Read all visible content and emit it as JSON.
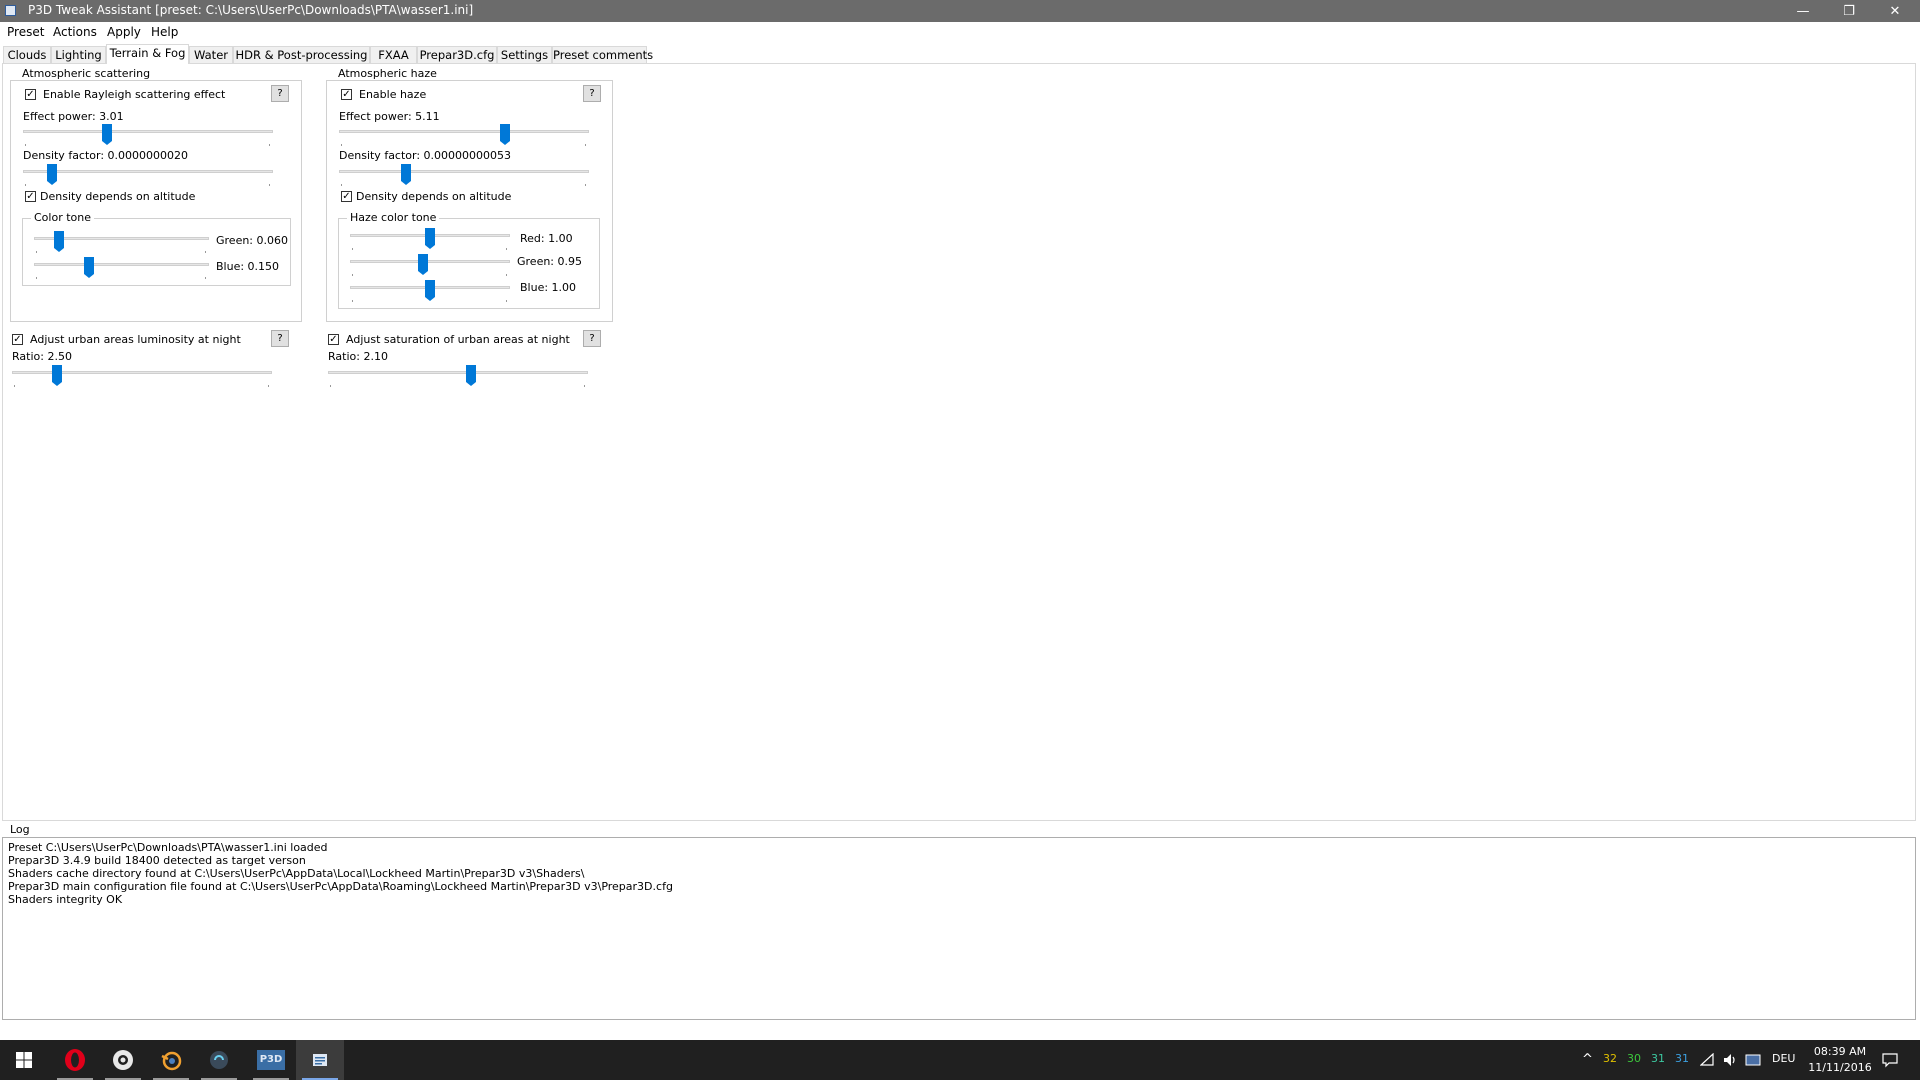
{
  "window": {
    "title": "P3D Tweak Assistant [preset: C:\\Users\\UserPc\\Downloads\\PTA\\wasser1.ini]",
    "minimize_glyph": "—",
    "restore_glyph": "❐",
    "close_glyph": "✕"
  },
  "menu": [
    "Preset",
    "Actions",
    "Apply",
    "Help"
  ],
  "tabs": [
    "Clouds",
    "Lighting",
    "Terrain & Fog",
    "Water",
    "HDR & Post-processing",
    "FXAA",
    "Prepar3D.cfg",
    "Settings",
    "Preset comments"
  ],
  "active_tab": "Terrain & Fog",
  "scattering": {
    "group_title": "Atmospheric scattering",
    "enable_label": "Enable Rayleigh scattering effect",
    "enable_checked": true,
    "help": "?",
    "effect_power_label": "Effect power: 3.01",
    "effect_power_fraction": 0.33,
    "density_factor_label": "Density factor: 0.0000000020",
    "density_factor_fraction": 0.1,
    "density_altitude_label": "Density depends on altitude",
    "density_altitude_checked": true,
    "color_tone": {
      "title": "Color tone",
      "green_label": "Green: 0.060",
      "green_fraction": 0.12,
      "blue_label": "Blue: 0.150",
      "blue_fraction": 0.3
    }
  },
  "haze": {
    "group_title": "Atmospheric haze",
    "enable_label": "Enable haze",
    "enable_checked": true,
    "help": "?",
    "effect_power_label": "Effect power: 5.11",
    "effect_power_fraction": 0.67,
    "density_factor_label": "Density factor: 0.00000000053",
    "density_factor_fraction": 0.26,
    "density_altitude_label": "Density depends on altitude",
    "density_altitude_checked": true,
    "color_tone": {
      "title": "Haze color tone",
      "red_label": "Red: 1.00",
      "red_fraction": 0.5,
      "green_label": "Green: 0.95",
      "green_fraction": 0.45,
      "blue_label": "Blue: 1.00",
      "blue_fraction": 0.5
    }
  },
  "urban_luminosity": {
    "label": "Adjust urban areas luminosity at night",
    "checked": true,
    "help": "?",
    "ratio_label": "Ratio: 2.50",
    "ratio_fraction": 0.16
  },
  "urban_saturation": {
    "label": "Adjust saturation of urban areas at night",
    "checked": true,
    "help": "?",
    "ratio_label": "Ratio: 2.10",
    "ratio_fraction": 0.55
  },
  "log": {
    "title": "Log",
    "lines": [
      "Preset C:\\Users\\UserPc\\Downloads\\PTA\\wasser1.ini loaded",
      "Prepar3D 3.4.9 build 18400 detected as target verson",
      "Shaders cache directory found at C:\\Users\\UserPc\\AppData\\Local\\Lockheed Martin\\Prepar3D v3\\Shaders\\",
      "Prepar3D main configuration file found at C:\\Users\\UserPc\\AppData\\Roaming\\Lockheed Martin\\Prepar3D v3\\Prepar3D.cfg",
      "Shaders integrity OK"
    ]
  },
  "taskbar": {
    "apps": [
      "opera-icon",
      "steam-icon",
      "blender-icon",
      "app-icon",
      "p3d-icon",
      "notes-icon"
    ],
    "p3d_text": "P3D",
    "tray_numbers": [
      {
        "value": "32",
        "color": "#e0c000"
      },
      {
        "value": "30",
        "color": "#3cc83c"
      },
      {
        "value": "31",
        "color": "#3cc8a0"
      },
      {
        "value": "31",
        "color": "#3ca0e0"
      }
    ],
    "language": "DEU",
    "time": "08:39 AM",
    "date": "11/11/2016"
  }
}
